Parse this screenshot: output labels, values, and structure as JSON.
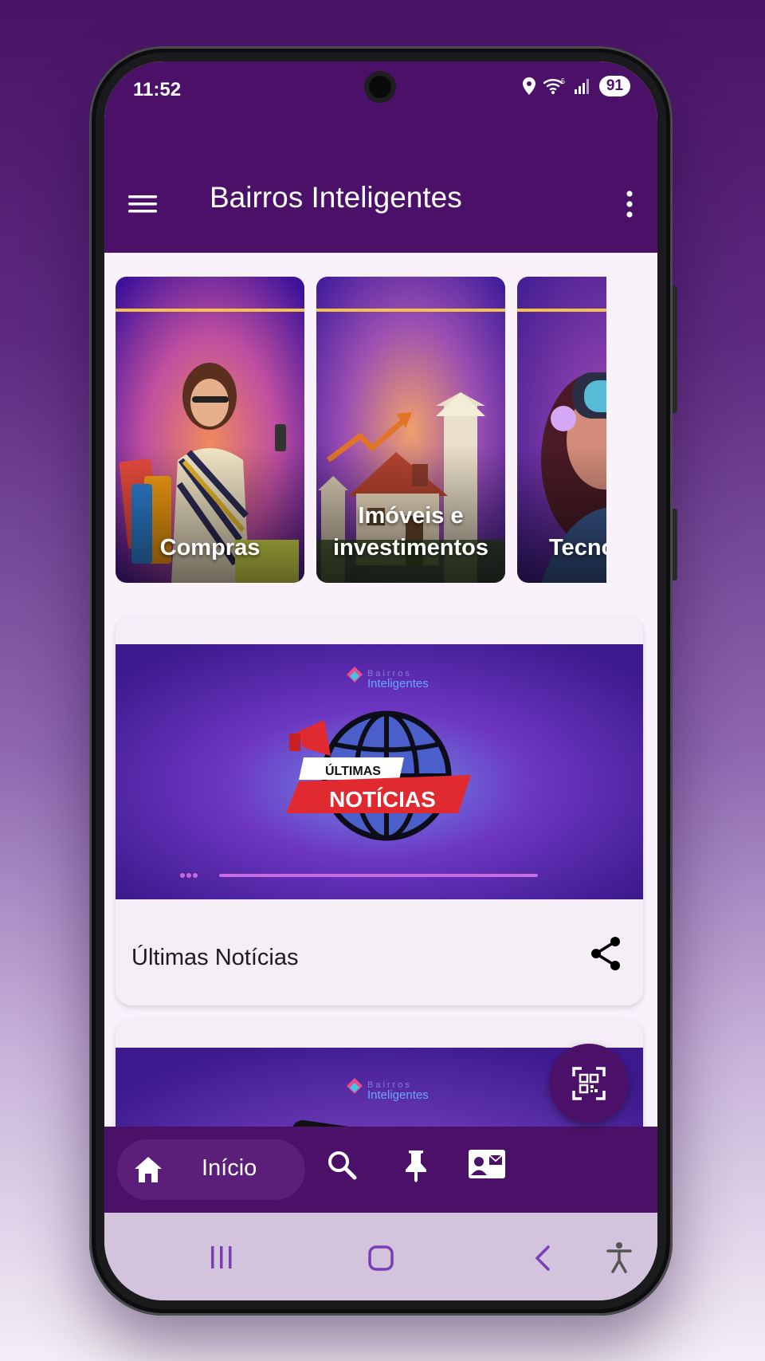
{
  "status_bar": {
    "time": "11:52",
    "battery": "91"
  },
  "app_bar": {
    "title": "Bairros Inteligentes",
    "menu_icon": "hamburger-menu-icon",
    "more_icon": "more-vert-icon"
  },
  "categories": [
    {
      "label_line1": "Compras",
      "label_line2": ""
    },
    {
      "label_line1": "Imóveis e",
      "label_line2": "investimentos"
    },
    {
      "label_line1": "Tecnologia",
      "label_line2": ""
    }
  ],
  "news_cards": [
    {
      "title": "Últimas Notícias",
      "banner": {
        "brand_top": "Bairros",
        "brand_bottom": "Inteligentes",
        "tag_small": "ÚLTIMAS",
        "tag_big": "NOTÍCIAS"
      }
    },
    {
      "title": "",
      "banner": {
        "brand_top": "Bairros",
        "brand_bottom": "Inteligentes"
      }
    }
  ],
  "bottom_nav": {
    "items": [
      {
        "label": "Início",
        "icon": "home-icon",
        "active": true
      },
      {
        "label": "",
        "icon": "search-icon",
        "active": false
      },
      {
        "label": "",
        "icon": "pin-icon",
        "active": false
      },
      {
        "label": "",
        "icon": "contact-card-icon",
        "active": false
      }
    ],
    "fab_icon": "qr-code-scanner-icon"
  },
  "system_nav": {
    "icons": [
      "recents-icon",
      "home-outline-icon",
      "back-icon",
      "accessibility-icon"
    ]
  },
  "colors": {
    "primary": "#4b1168",
    "accent_gold": "#f2c14e",
    "surface": "#faf2fb",
    "tag_red": "#e12a2f"
  }
}
